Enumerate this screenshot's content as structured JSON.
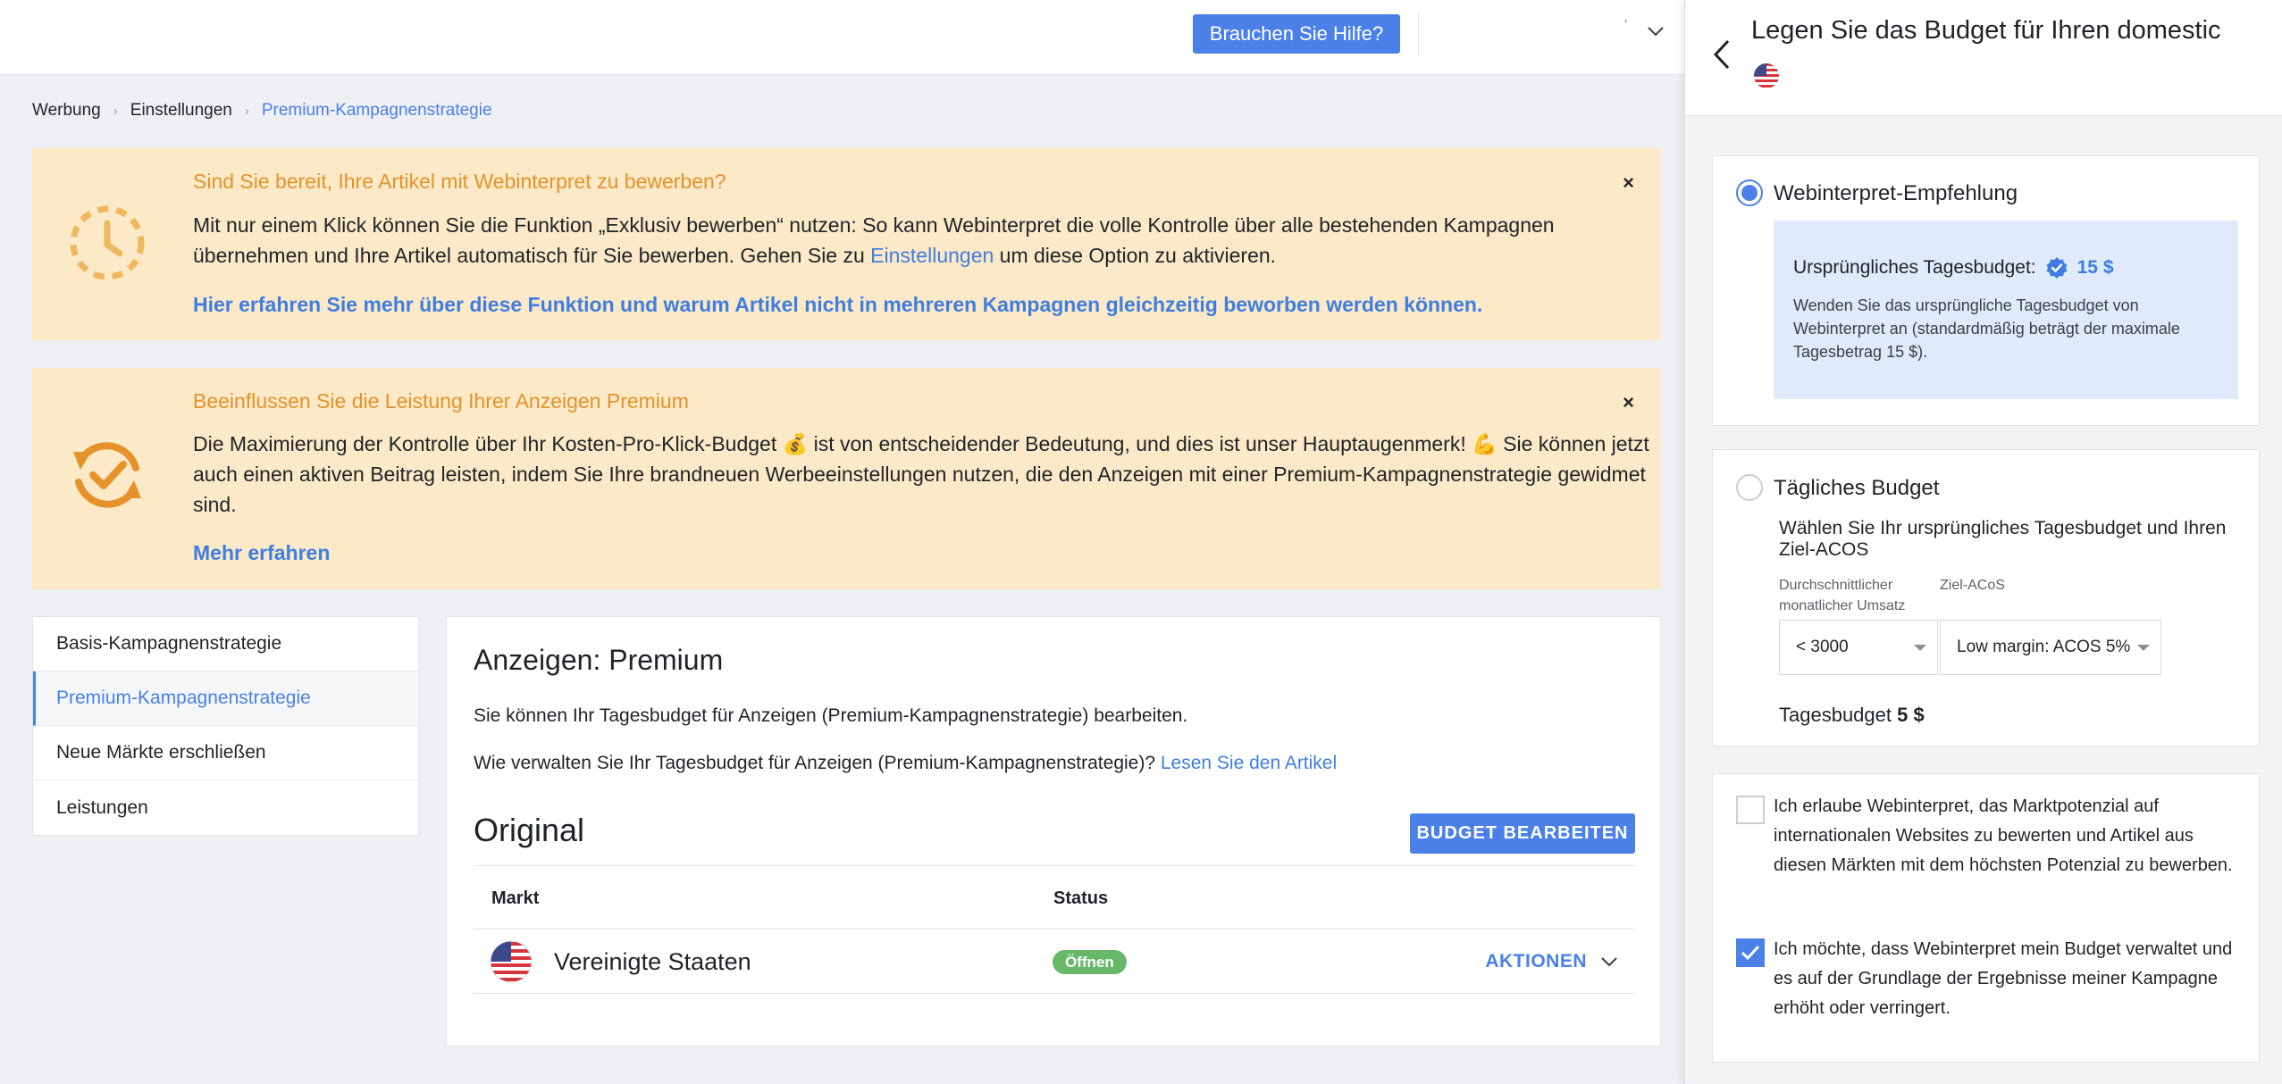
{
  "topbar": {
    "help_label": "Brauchen Sie Hilfe?",
    "dot": "'",
    "chevron_icon": "chevron-down-icon"
  },
  "breadcrumb": [
    "Werbung",
    "Einstellungen",
    "Premium-Kampagnenstrategie"
  ],
  "banner1": {
    "title": "Sind Sie bereit, Ihre Artikel mit Webinterpret zu bewerben?",
    "text_before": "Mit nur einem Klick können Sie die Funktion „Exklusiv bewerben“ nutzen: So kann Webinterpret die volle Kontrolle über alle bestehenden Kampagnen übernehmen und Ihre Artikel automatisch für Sie bewerben. Gehen Sie zu ",
    "text_link": "Einstellungen",
    "text_after": " um diese Option zu aktivieren.",
    "link": "Hier erfahren Sie mehr über diese Funktion und warum Artikel nicht in mehreren Kampagnen gleichzeitig beworben werden können.",
    "close": "×",
    "icon": "clock-icon"
  },
  "banner2": {
    "title": "Beeinflussen Sie die Leistung Ihrer Anzeigen Premium",
    "text": "Die Maximierung der Kontrolle über Ihr Kosten-Pro-Klick-Budget 💰 ist von entscheidender Bedeutung, und dies ist unser Hauptaugenmerk! 💪 Sie können jetzt auch einen aktiven Beitrag leisten, indem Sie Ihre brandneuen Werbeeinstellungen nutzen, die den Anzeigen mit einer Premium-Kampagnenstrategie gewidmet sind.",
    "link": "Mehr erfahren",
    "close": "×",
    "icon": "refresh-check-icon"
  },
  "sidenav": {
    "items": [
      {
        "label": "Basis-Kampagnenstrategie"
      },
      {
        "label": "Premium-Kampagnenstrategie"
      },
      {
        "label": "Neue Märkte erschließen"
      },
      {
        "label": "Leistungen"
      }
    ],
    "active_index": 1
  },
  "main": {
    "title": "Anzeigen: Premium",
    "p1": "Sie können Ihr Tagesbudget für Anzeigen (Premium-Kampagnenstrategie) bearbeiten.",
    "p2_text": "Wie verwalten Sie Ihr Tagesbudget für Anzeigen (Premium-Kampagnenstrategie)? ",
    "p2_link": "Lesen Sie den Artikel",
    "original_heading": "Original",
    "edit_button": "BUDGET BEARBEITEN",
    "table": {
      "col_market": "Markt",
      "col_status": "Status",
      "rows": [
        {
          "market": "Vereinigte Staaten",
          "status": "Öffnen",
          "actions": "AKTIONEN",
          "flag": "us-flag-icon"
        }
      ]
    }
  },
  "panel": {
    "title": "Legen Sie das Budget für Ihren domestic",
    "flag": "us-flag-icon",
    "back_icon": "chevron-left-icon",
    "option1": {
      "label": "Webinterpret-Empfehlung",
      "selected": true,
      "budget_label": "Ursprüngliches Tagesbudget:",
      "budget_value": "15 $",
      "desc": "Wenden Sie das ursprüngliche Tagesbudget von Webinterpret an (standardmäßig beträgt der maximale Tagesbetrag 15 $).",
      "check_icon": "verified-badge-icon"
    },
    "option2": {
      "label": "Tägliches Budget",
      "selected": false,
      "subtitle": "Wählen Sie Ihr ursprüngliches Tagesbudget und Ihren Ziel-ACOS",
      "label_sales": "Durchschnittlicher monatlicher Umsatz",
      "label_acos": "Ziel-ACoS",
      "sales_value": "< 3000",
      "acos_value": "Low margin: ACOS 5%",
      "total_label": "Tagesbudget",
      "total_value": "5 $"
    },
    "checkboxes": [
      {
        "text": "Ich erlaube Webinterpret, das Marktpotenzial auf internationalen Websites zu bewerten und Artikel aus diesen Märkten mit dem höchsten Potenzial zu bewerben.",
        "checked": false
      },
      {
        "text": "Ich möchte, dass Webinterpret mein Budget verwaltet und es auf der Grundlage der Ergebnisse meiner Kampagne erhöht oder verringert.",
        "checked": true
      }
    ]
  },
  "colors": {
    "accent": "#4a80e8",
    "banner_bg": "#fbe9c7",
    "banner_title": "#e5922b",
    "status_green": "#68b86a",
    "reco_bg": "#dfeafb"
  }
}
